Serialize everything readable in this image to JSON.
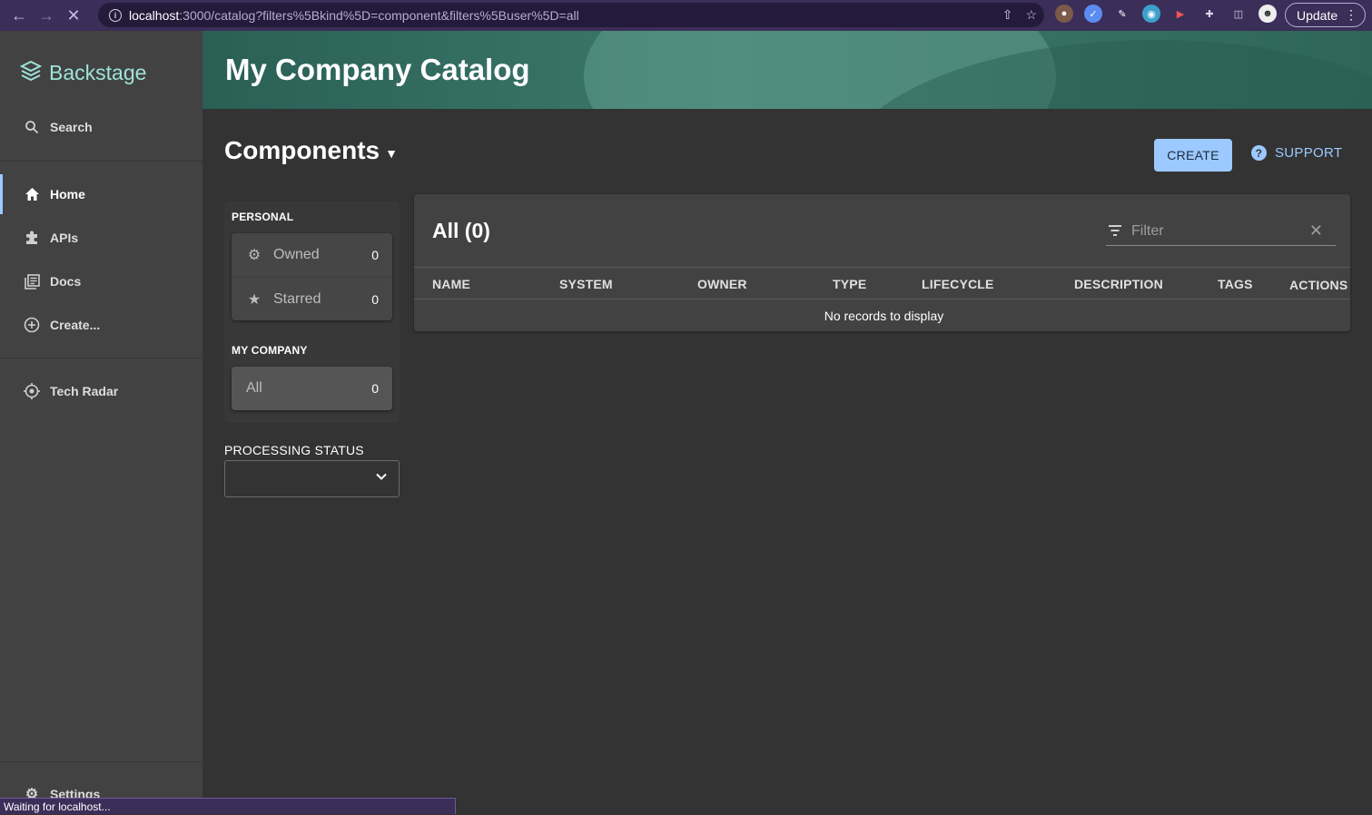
{
  "browser": {
    "url_host": "localhost",
    "url_rest": ":3000/catalog?filters%5Bkind%5D=component&filters%5Buser%5D=all",
    "update_label": "Update",
    "status_text": "Waiting for localhost..."
  },
  "sidebar": {
    "logo_text": "Backstage",
    "search_label": "Search",
    "items": [
      {
        "label": "Home",
        "icon": "home-icon"
      },
      {
        "label": "APIs",
        "icon": "puzzle-icon"
      },
      {
        "label": "Docs",
        "icon": "docs-icon"
      },
      {
        "label": "Create...",
        "icon": "add-circle-icon"
      }
    ],
    "plugins": [
      {
        "label": "Tech Radar",
        "icon": "radar-icon"
      }
    ],
    "settings_label": "Settings"
  },
  "header": {
    "title": "My Company Catalog"
  },
  "main": {
    "heading": "Components",
    "create_label": "CREATE",
    "support_label": "SUPPORT"
  },
  "filters": {
    "personal_label": "PERSONAL",
    "owned_label": "Owned",
    "owned_count": "0",
    "starred_label": "Starred",
    "starred_count": "0",
    "company_label": "MY COMPANY",
    "all_label": "All",
    "all_count": "0",
    "processing_label": "PROCESSING STATUS"
  },
  "table": {
    "title": "All (0)",
    "filter_placeholder": "Filter",
    "columns": [
      "NAME",
      "SYSTEM",
      "OWNER",
      "TYPE",
      "LIFECYCLE",
      "DESCRIPTION",
      "TAGS",
      "ACTIONS"
    ],
    "empty_text": "No records to display"
  },
  "colors": {
    "accent": "#9cc9ff",
    "logo": "#9fe3d7",
    "sidebar_bg": "#424242",
    "page_bg": "#333333"
  }
}
